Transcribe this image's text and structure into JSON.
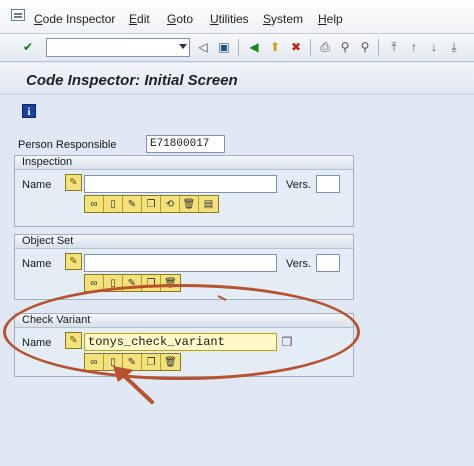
{
  "menu": {
    "items": [
      "Code Inspector",
      "Edit",
      "Goto",
      "Utilities",
      "System",
      "Help"
    ],
    "underline": [
      "C",
      "E",
      "G",
      "U",
      "S",
      "H"
    ]
  },
  "toolbar": {
    "command_value": ""
  },
  "title": "Code Inspector: Initial Screen",
  "info_icon_label": "i",
  "person_responsible": {
    "label": "Person Responsible",
    "value": "E71800017"
  },
  "inspection": {
    "title": "Inspection",
    "name_label": "Name",
    "name_value": "",
    "vers_label": "Vers.",
    "vers_value": ""
  },
  "object_set": {
    "title": "Object Set",
    "name_label": "Name",
    "name_value": "",
    "vers_label": "Vers.",
    "vers_value": ""
  },
  "check_variant": {
    "title": "Check Variant",
    "name_label": "Name",
    "name_value": "tonys_check_variant"
  },
  "colors": {
    "annotation": "#b8522f",
    "button_yellow": "#f3e17b",
    "background": "#dfe8f3"
  }
}
